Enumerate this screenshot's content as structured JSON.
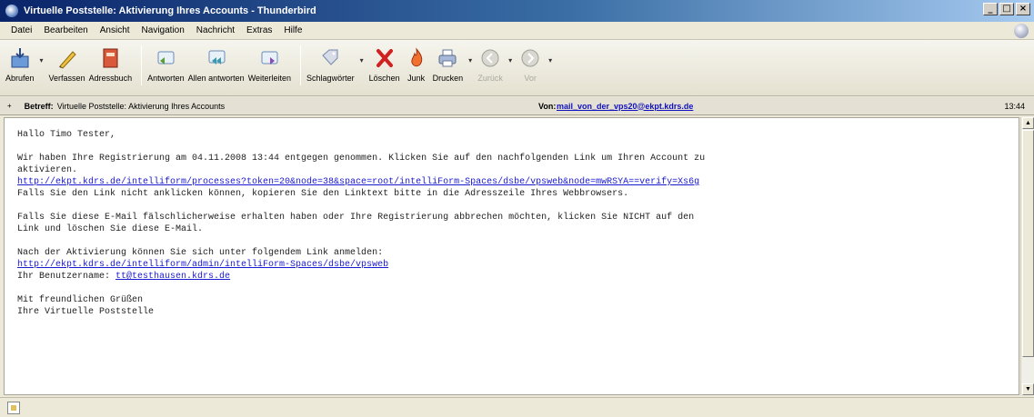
{
  "window": {
    "title": "Virtuelle Poststelle: Aktivierung Ihres Accounts - Thunderbird",
    "minimize": "_",
    "maximize": "□",
    "close": "×"
  },
  "menu": {
    "items": [
      "Datei",
      "Bearbeiten",
      "Ansicht",
      "Navigation",
      "Nachricht",
      "Extras",
      "Hilfe"
    ]
  },
  "toolbar": {
    "buttons": [
      {
        "label": "Abrufen",
        "icon": "get-mail-icon",
        "dropdown": true,
        "enabled": true
      },
      {
        "label": "Verfassen",
        "icon": "compose-icon",
        "dropdown": false,
        "enabled": true
      },
      {
        "label": "Adressbuch",
        "icon": "address-book-icon",
        "dropdown": false,
        "enabled": true
      },
      {
        "label": "Antworten",
        "icon": "reply-icon",
        "dropdown": false,
        "enabled": true
      },
      {
        "label": "Allen antworten",
        "icon": "reply-all-icon",
        "dropdown": false,
        "enabled": true
      },
      {
        "label": "Weiterleiten",
        "icon": "forward-icon",
        "dropdown": false,
        "enabled": true
      },
      {
        "label": "Schlagwörter",
        "icon": "tag-icon",
        "dropdown": true,
        "enabled": true
      },
      {
        "label": "Löschen",
        "icon": "delete-icon",
        "dropdown": false,
        "enabled": true
      },
      {
        "label": "Junk",
        "icon": "junk-icon",
        "dropdown": false,
        "enabled": true
      },
      {
        "label": "Drucken",
        "icon": "print-icon",
        "dropdown": true,
        "enabled": true
      },
      {
        "label": "Zurück",
        "icon": "back-icon",
        "dropdown": true,
        "enabled": false
      },
      {
        "label": "Vor",
        "icon": "forward-nav-icon",
        "dropdown": true,
        "enabled": false
      }
    ]
  },
  "header": {
    "subject_label": "Betreff:",
    "subject": "Virtuelle Poststelle: Aktivierung Ihres Accounts",
    "from_label": "Von:",
    "from": "mail_von_der_vps20@ekpt.kdrs.de",
    "time": "13:44"
  },
  "message": {
    "lines": [
      {
        "text": "Hallo Timo Tester,",
        "link": false
      },
      {
        "text": "",
        "link": false
      },
      {
        "text": "Wir haben Ihre Registrierung am 04.11.2008 13:44 entgegen genommen. Klicken Sie auf den nachfolgenden Link um Ihren Account zu",
        "link": false
      },
      {
        "text": "aktivieren.",
        "link": false
      },
      {
        "text": "http://ekpt.kdrs.de/intelliform/processes?token=20&node=38&space=root/intelliForm-Spaces/dsbe/vpsweb&node=mwRSYA==verify=Xs6g",
        "link": true
      },
      {
        "text": "Falls Sie den Link nicht anklicken können, kopieren Sie den Linktext bitte in die Adresszeile Ihres Webbrowsers.",
        "link": false
      },
      {
        "text": "",
        "link": false
      },
      {
        "text": "Falls Sie diese E-Mail fälschlicherweise erhalten haben oder Ihre Registrierung abbrechen möchten, klicken Sie NICHT auf den",
        "link": false
      },
      {
        "text": "Link und löschen Sie diese E-Mail.",
        "link": false
      },
      {
        "text": "",
        "link": false
      },
      {
        "text": "Nach der Aktivierung können Sie sich unter folgendem Link anmelden:",
        "link": false
      },
      {
        "text": "http://ekpt.kdrs.de/intelliform/admin/intelliForm-Spaces/dsbe/vpsweb",
        "link": true
      },
      {
        "text": "Ihr Benutzername: ",
        "link": false,
        "suffix_link": "tt@testhausen.kdrs.de"
      },
      {
        "text": "",
        "link": false
      },
      {
        "text": "Mit freundlichen Grüßen",
        "link": false
      },
      {
        "text": "Ihre Virtuelle Poststelle",
        "link": false
      }
    ]
  },
  "colors": {
    "link": "#1a1ad0",
    "titlebar_start": "#0a246a",
    "titlebar_end": "#a6caf0"
  }
}
